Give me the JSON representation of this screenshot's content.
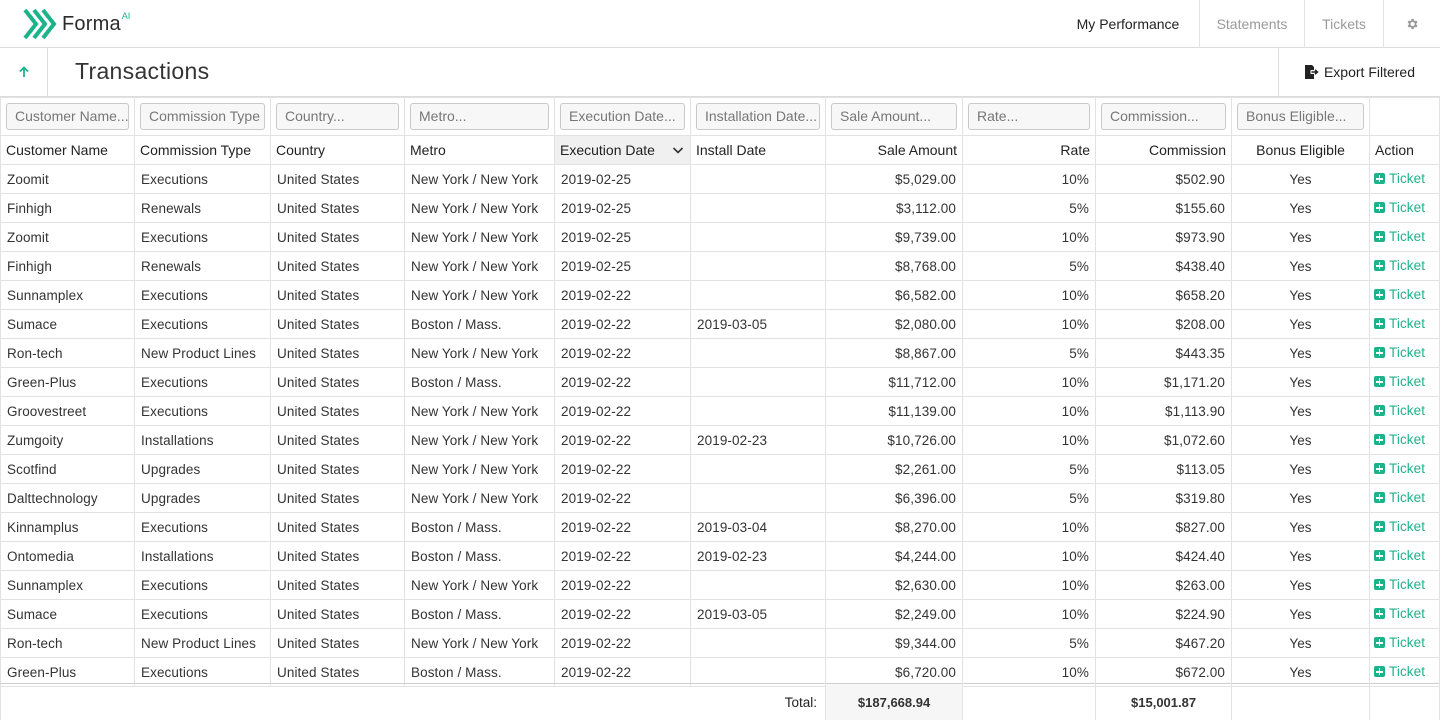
{
  "app": {
    "brand_name": "Forma",
    "brand_sup": "AI",
    "brand_color": "#1eb28a",
    "logo_icon": "forma-chevrons-logo"
  },
  "nav": {
    "items": [
      {
        "label": "My Performance",
        "active": true
      },
      {
        "label": "Statements",
        "active": false
      },
      {
        "label": "Tickets",
        "active": false
      }
    ],
    "settings_icon": "gear-icon"
  },
  "page": {
    "title": "Transactions",
    "back_icon": "arrow-up-icon",
    "export_label": "Export Filtered",
    "export_icon": "export-file-icon"
  },
  "filters": [
    "Customer Name...",
    "Commission Type",
    "Country...",
    "Metro...",
    "Execution Date...",
    "Installation Date...",
    "Sale Amount...",
    "Rate...",
    "Commission...",
    "Bonus Eligible..."
  ],
  "columns": [
    "Customer Name",
    "Commission Type",
    "Country",
    "Metro",
    "Execution Date",
    "Install Date",
    "Sale Amount",
    "Rate",
    "Commission",
    "Bonus Eligible",
    "Action"
  ],
  "sorted_column": "Execution Date",
  "rows": [
    [
      "Zoomit",
      "Executions",
      "United States",
      "New York / New York",
      "2019-02-25",
      "",
      "$5,029.00",
      "10%",
      "$502.90",
      "Yes",
      "Ticket"
    ],
    [
      "Finhigh",
      "Renewals",
      "United States",
      "New York / New York",
      "2019-02-25",
      "",
      "$3,112.00",
      "5%",
      "$155.60",
      "Yes",
      "Ticket"
    ],
    [
      "Zoomit",
      "Executions",
      "United States",
      "New York / New York",
      "2019-02-25",
      "",
      "$9,739.00",
      "10%",
      "$973.90",
      "Yes",
      "Ticket"
    ],
    [
      "Finhigh",
      "Renewals",
      "United States",
      "New York / New York",
      "2019-02-25",
      "",
      "$8,768.00",
      "5%",
      "$438.40",
      "Yes",
      "Ticket"
    ],
    [
      "Sunnamplex",
      "Executions",
      "United States",
      "New York / New York",
      "2019-02-22",
      "",
      "$6,582.00",
      "10%",
      "$658.20",
      "Yes",
      "Ticket"
    ],
    [
      "Sumace",
      "Executions",
      "United States",
      "Boston / Mass.",
      "2019-02-22",
      "2019-03-05",
      "$2,080.00",
      "10%",
      "$208.00",
      "Yes",
      "Ticket"
    ],
    [
      "Ron-tech",
      "New Product Lines",
      "United States",
      "New York / New York",
      "2019-02-22",
      "",
      "$8,867.00",
      "5%",
      "$443.35",
      "Yes",
      "Ticket"
    ],
    [
      "Green-Plus",
      "Executions",
      "United States",
      "Boston / Mass.",
      "2019-02-22",
      "",
      "$11,712.00",
      "10%",
      "$1,171.20",
      "Yes",
      "Ticket"
    ],
    [
      "Groovestreet",
      "Executions",
      "United States",
      "New York / New York",
      "2019-02-22",
      "",
      "$11,139.00",
      "10%",
      "$1,113.90",
      "Yes",
      "Ticket"
    ],
    [
      "Zumgoity",
      "Installations",
      "United States",
      "New York / New York",
      "2019-02-22",
      "2019-02-23",
      "$10,726.00",
      "10%",
      "$1,072.60",
      "Yes",
      "Ticket"
    ],
    [
      "Scotfind",
      "Upgrades",
      "United States",
      "New York / New York",
      "2019-02-22",
      "",
      "$2,261.00",
      "5%",
      "$113.05",
      "Yes",
      "Ticket"
    ],
    [
      "Dalttechnology",
      "Upgrades",
      "United States",
      "New York / New York",
      "2019-02-22",
      "",
      "$6,396.00",
      "5%",
      "$319.80",
      "Yes",
      "Ticket"
    ],
    [
      "Kinnamplus",
      "Executions",
      "United States",
      "Boston / Mass.",
      "2019-02-22",
      "2019-03-04",
      "$8,270.00",
      "10%",
      "$827.00",
      "Yes",
      "Ticket"
    ],
    [
      "Ontomedia",
      "Installations",
      "United States",
      "Boston / Mass.",
      "2019-02-22",
      "2019-02-23",
      "$4,244.00",
      "10%",
      "$424.40",
      "Yes",
      "Ticket"
    ],
    [
      "Sunnamplex",
      "Executions",
      "United States",
      "New York / New York",
      "2019-02-22",
      "",
      "$2,630.00",
      "10%",
      "$263.00",
      "Yes",
      "Ticket"
    ],
    [
      "Sumace",
      "Executions",
      "United States",
      "Boston / Mass.",
      "2019-02-22",
      "2019-03-05",
      "$2,249.00",
      "10%",
      "$224.90",
      "Yes",
      "Ticket"
    ],
    [
      "Ron-tech",
      "New Product Lines",
      "United States",
      "New York / New York",
      "2019-02-22",
      "",
      "$9,344.00",
      "5%",
      "$467.20",
      "Yes",
      "Ticket"
    ],
    [
      "Green-Plus",
      "Executions",
      "United States",
      "Boston / Mass.",
      "2019-02-22",
      "",
      "$6,720.00",
      "10%",
      "$672.00",
      "Yes",
      "Ticket"
    ]
  ],
  "totals": {
    "label": "Total:",
    "sale_amount": "$187,668.94",
    "commission": "$15,001.87"
  }
}
